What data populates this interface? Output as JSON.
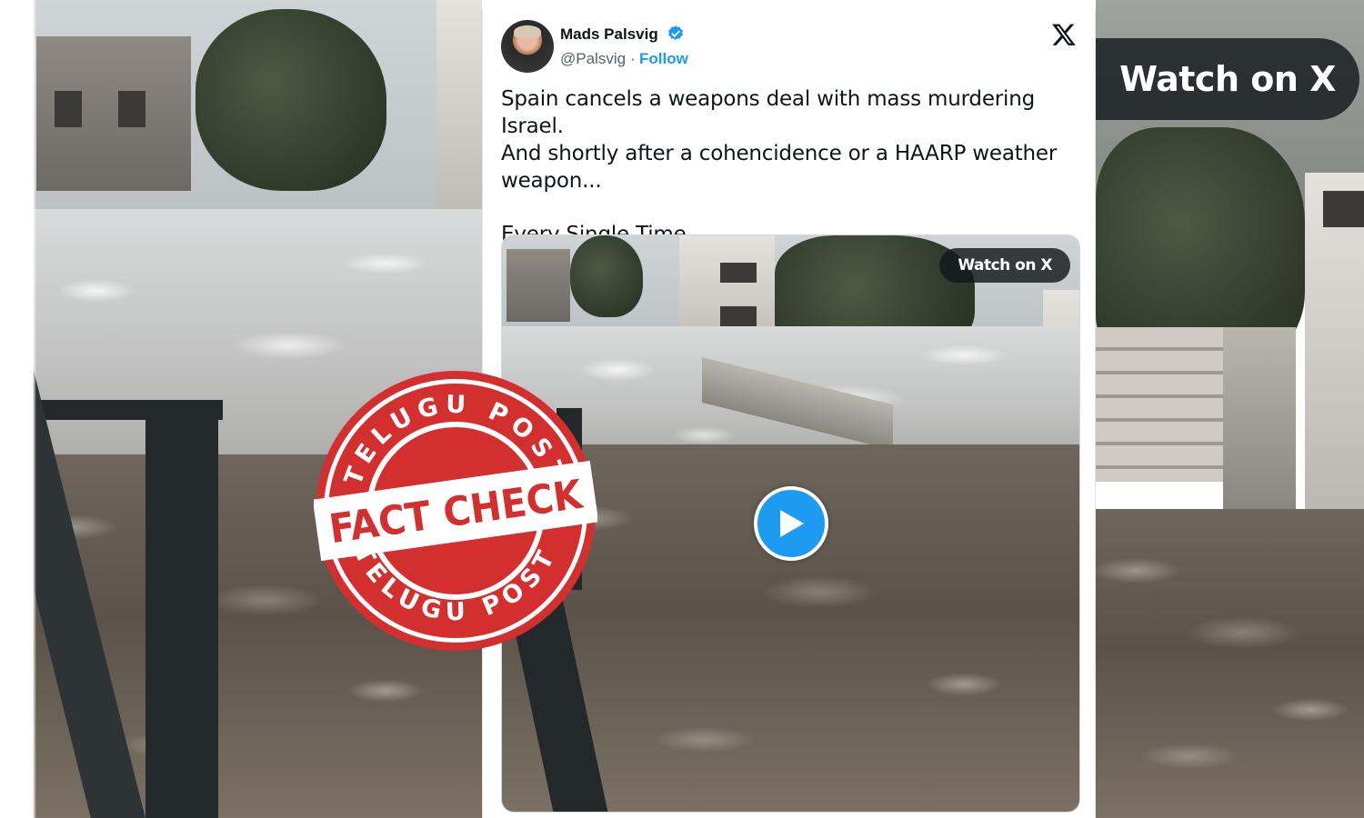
{
  "tweet": {
    "author_name": "Mads Palsvig",
    "handle": "@Palsvig",
    "separator": "·",
    "follow_label": "Follow",
    "text_lines": [
      "Spain cancels a weapons deal with mass murdering Israel.",
      "And shortly after a cohencidence or a HAARP weather",
      "weapon...",
      "Every Single Time"
    ]
  },
  "video": {
    "watch_label": "Watch on X",
    "play_icon": "play-icon"
  },
  "background": {
    "watch_label": "Watch on X"
  },
  "stamp": {
    "top_text": "TELUGU POST",
    "center_text": "FACT CHECK",
    "bottom_text": "TELUGU POST"
  },
  "colors": {
    "accent_blue": "#1d9bf0",
    "stamp_red": "#d32f2f",
    "text_primary": "#0f1419",
    "text_secondary": "#536471"
  },
  "icons": [
    "verified-badge-icon",
    "x-logo-icon",
    "play-icon"
  ]
}
